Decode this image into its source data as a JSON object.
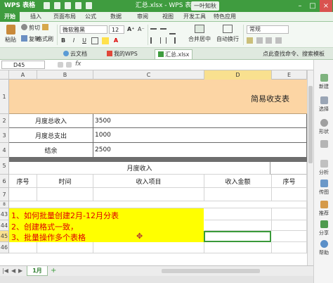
{
  "titlebar": {
    "app_button": "WPS 表格",
    "window_title": "汇总.xlsx - WPS 表格",
    "user": "一叶知秋",
    "minimize": "–",
    "maximize": "□",
    "close": "×"
  },
  "tabs": [
    "开始",
    "插入",
    "页面布局",
    "公式",
    "数据",
    "审阅",
    "视图",
    "开发工具",
    "特色应用"
  ],
  "ribbon": {
    "cut": "剪切",
    "copy": "复制",
    "paste": "粘贴",
    "format_painter": "格式刷",
    "font_name": "微软雅黑",
    "font_size": "12",
    "merge": "合并居中",
    "wrap": "自动换行",
    "number_format": "常规",
    "bold": "B",
    "italic": "I",
    "underline": "U"
  },
  "doc_tabs": {
    "cloud": "云文档",
    "my_wps": "我的WPS",
    "file": "汇总.xlsx",
    "tip": "点此查找命令、搜索模板"
  },
  "formula_bar": {
    "cell_ref": "D45",
    "fx": "fx",
    "content": ""
  },
  "columns": [
    "A",
    "B",
    "C",
    "D",
    "E"
  ],
  "selected_column": "D",
  "rows": [
    "1",
    "2",
    "3",
    "4",
    "5",
    "6",
    "7",
    "8",
    "9",
    "43",
    "44",
    "45",
    "46"
  ],
  "selected_row": "45",
  "sheet": {
    "title": "简易收支表",
    "summary": [
      {
        "label": "月度总收入",
        "value": "3500"
      },
      {
        "label": "月度总支出",
        "value": "1000"
      },
      {
        "label": "结余",
        "value": "2500"
      }
    ],
    "income_header": "月度收入",
    "income_columns": [
      "序号",
      "时间",
      "收入项目",
      "收入金额"
    ],
    "right_columns": [
      "序号"
    ]
  },
  "notes": [
    "1、如何批量创建2月-12月分表",
    "2、创建格式一致，",
    "3、批量操作多个表格"
  ],
  "right_panel": [
    "新建",
    "选择",
    "形状",
    "",
    "分析",
    "传图",
    "推荐",
    "分享",
    "帮助"
  ],
  "sheet_tabs": {
    "active": "1月",
    "add": "+"
  }
}
